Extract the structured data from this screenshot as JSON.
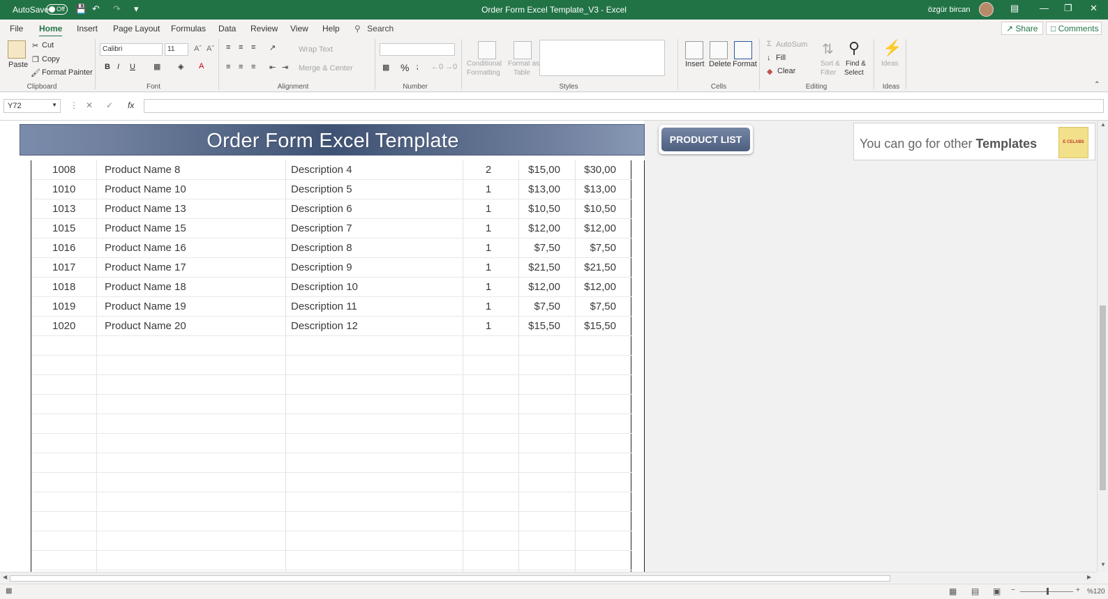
{
  "titlebar": {
    "autosave_label": "AutoSave",
    "autosave_state": "Off",
    "document_title": "Order Form Excel Template_V3  -  Excel",
    "user_name": "özgür bircan"
  },
  "ribbon_tabs": {
    "file": "File",
    "home": "Home",
    "insert": "Insert",
    "page_layout": "Page Layout",
    "formulas": "Formulas",
    "data": "Data",
    "review": "Review",
    "view": "View",
    "help": "Help",
    "search": "Search",
    "share": "Share",
    "comments": "Comments"
  },
  "ribbon": {
    "clipboard": {
      "paste": "Paste",
      "cut": "Cut",
      "copy": "Copy",
      "format_painter": "Format Painter",
      "label": "Clipboard"
    },
    "font": {
      "font_name": "Calibri",
      "font_size": "11",
      "bold": "B",
      "italic": "I",
      "underline": "U",
      "label": "Font"
    },
    "alignment": {
      "wrap_text": "Wrap Text",
      "merge_center": "Merge & Center",
      "label": "Alignment"
    },
    "number": {
      "percent": "%",
      "label": "Number"
    },
    "styles": {
      "conditional_formatting_1": "Conditional",
      "conditional_formatting_2": "Formatting",
      "format_as_table_1": "Format as",
      "format_as_table_2": "Table",
      "label": "Styles"
    },
    "cells": {
      "insert": "Insert",
      "delete": "Delete",
      "format": "Format",
      "label": "Cells"
    },
    "editing": {
      "autosum": "AutoSum",
      "fill": "Fill",
      "clear": "Clear",
      "sort_filter_1": "Sort &",
      "sort_filter_2": "Filter",
      "find_select_1": "Find &",
      "find_select_2": "Select",
      "label": "Editing"
    },
    "ideas": {
      "ideas": "Ideas",
      "label": "Ideas"
    }
  },
  "formula_bar": {
    "name_box": "Y72",
    "fx": "fx",
    "formula": ""
  },
  "sheet": {
    "banner_title": "Order Form Excel Template",
    "product_list_button": "PRODUCT LIST",
    "promo_text_prefix": "You can go for other ",
    "promo_text_bold": "Templates",
    "promo_logo_text": "E CELABS",
    "rows": [
      {
        "id": "1008",
        "name": "Product Name 8",
        "desc": "Description 4",
        "qty": "2",
        "price": "$15,00",
        "total": "$30,00"
      },
      {
        "id": "1010",
        "name": "Product Name 10",
        "desc": "Description 5",
        "qty": "1",
        "price": "$13,00",
        "total": "$13,00"
      },
      {
        "id": "1013",
        "name": "Product Name 13",
        "desc": "Description 6",
        "qty": "1",
        "price": "$10,50",
        "total": "$10,50"
      },
      {
        "id": "1015",
        "name": "Product Name 15",
        "desc": "Description 7",
        "qty": "1",
        "price": "$12,00",
        "total": "$12,00"
      },
      {
        "id": "1016",
        "name": "Product Name 16",
        "desc": "Description 8",
        "qty": "1",
        "price": "$7,50",
        "total": "$7,50"
      },
      {
        "id": "1017",
        "name": "Product Name 17",
        "desc": "Description 9",
        "qty": "1",
        "price": "$21,50",
        "total": "$21,50"
      },
      {
        "id": "1018",
        "name": "Product Name 18",
        "desc": "Description 10",
        "qty": "1",
        "price": "$12,00",
        "total": "$12,00"
      },
      {
        "id": "1019",
        "name": "Product Name 19",
        "desc": "Description 11",
        "qty": "1",
        "price": "$7,50",
        "total": "$7,50"
      },
      {
        "id": "1020",
        "name": "Product Name 20",
        "desc": "Description 12",
        "qty": "1",
        "price": "$15,50",
        "total": "$15,50"
      }
    ]
  },
  "statusbar": {
    "zoom": "%120"
  },
  "colors": {
    "excel_green": "#217346",
    "banner_blue": "#4d5e7e"
  }
}
